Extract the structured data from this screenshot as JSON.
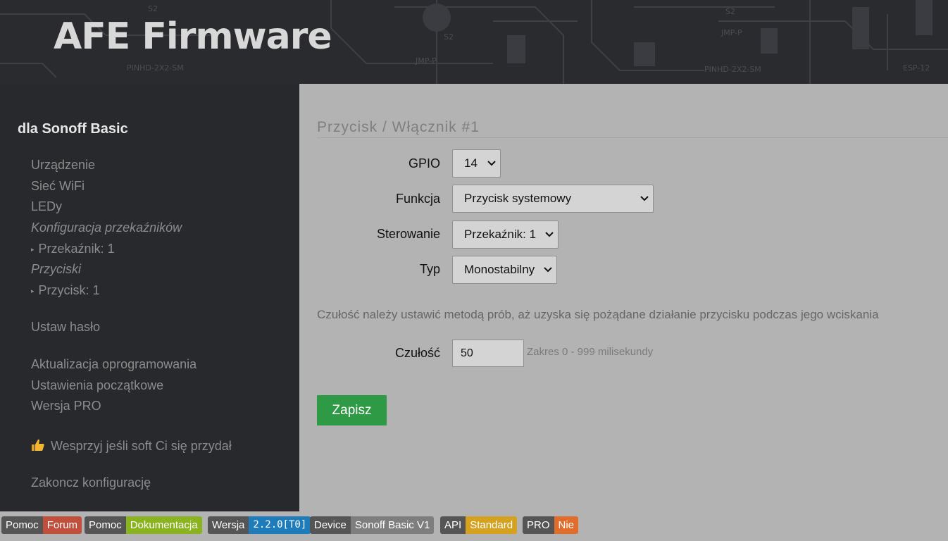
{
  "header": {
    "brand": "AFE Firmware"
  },
  "sidebar": {
    "device_title": "dla Sonoff Basic",
    "items": [
      {
        "label": "Urządzenie"
      },
      {
        "label": "Sieć WiFi"
      },
      {
        "label": "LEDy"
      },
      {
        "label": "Konfiguracja przekaźników"
      },
      {
        "label": "Przekaźnik: 1"
      },
      {
        "label": "Przyciski"
      },
      {
        "label": "Przycisk: 1"
      },
      {
        "label": "Ustaw hasło"
      },
      {
        "label": "Aktualizacja oprogramowania"
      },
      {
        "label": "Ustawienia początkowe"
      },
      {
        "label": "Wersja PRO"
      },
      {
        "label": "Wesprzyj jeśli soft Ci się przydał",
        "icon": "thumbs-up-icon"
      },
      {
        "label": "Zakoncz konfigurację"
      }
    ]
  },
  "form": {
    "title": "Przycisk / Włącznik #1",
    "gpio": {
      "label": "GPIO",
      "value": "14"
    },
    "funkcja": {
      "label": "Funkcja",
      "value": "Przycisk systemowy"
    },
    "sterowanie": {
      "label": "Sterowanie",
      "value": "Przekaźnik: 1"
    },
    "typ": {
      "label": "Typ",
      "value": "Monostabilny"
    },
    "hint": "Czułość należy ustawić metodą prób, aż uzyska się pożądane działanie przycisku podczas jego wciskania",
    "czulosc": {
      "label": "Czułość",
      "value": "50",
      "range": "Zakres 0 - 999 milisekundy"
    },
    "save_label": "Zapisz"
  },
  "footer": {
    "badges": [
      {
        "key": "Pomoc",
        "value": "Forum",
        "color": "#c0503c"
      },
      {
        "key": "Pomoc",
        "value": "Dokumentacja",
        "color": "#8ab41f"
      },
      {
        "key": "Wersja",
        "value": "2.2.0[T0]",
        "color": "#1f7cba"
      },
      {
        "key": "Device",
        "value": "Sonoff Basic V1",
        "color": "#7e7e7e"
      },
      {
        "key": "API",
        "value": "Standard",
        "color": "#d4a21f"
      },
      {
        "key": "PRO",
        "value": "Nie",
        "color": "#e06d2c"
      }
    ]
  }
}
